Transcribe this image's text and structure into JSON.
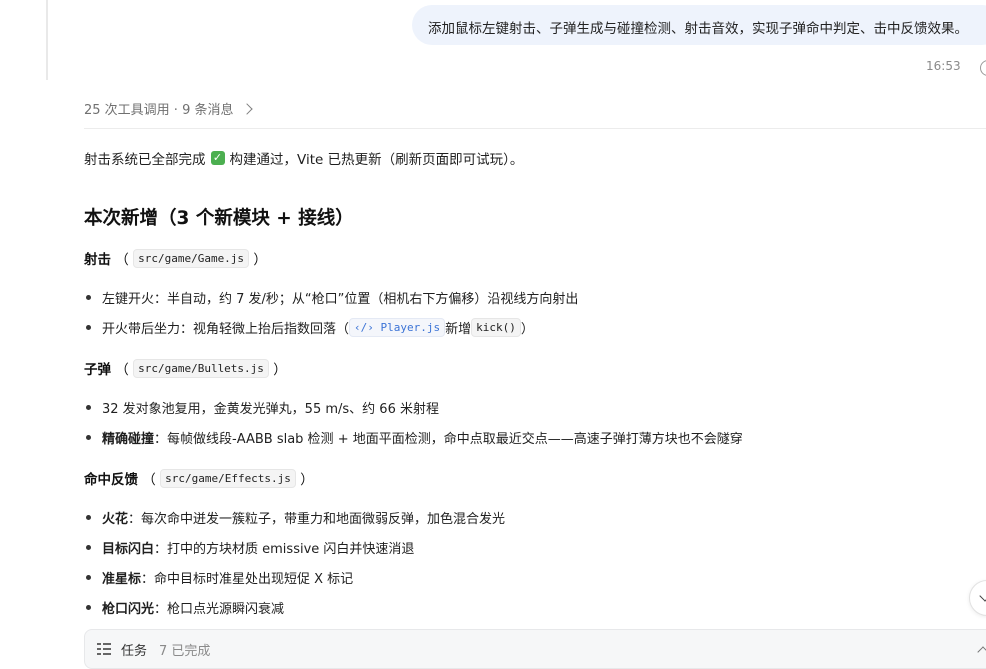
{
  "user_message": {
    "text": "添加鼠标左键射击、子弹生成与碰撞检测、射击音效，实现子弹命中判定、击中反馈效果。",
    "time": "16:53"
  },
  "tools_summary": "25 次工具调用 · 9 条消息",
  "intro": {
    "before": "射击系统已全部完成",
    "after": "构建通过，Vite 已热更新（刷新页面即可试玩）。"
  },
  "heading": "本次新增（3 个新模块 + 接线）",
  "sections": [
    {
      "title": "射击",
      "file": "src/game/Game.js",
      "bullets": [
        {
          "bold": "",
          "text": "左键开火：半自动，约 7 发/秒；从“枪口”位置（相机右下方偏移）沿视线方向射出"
        },
        {
          "bold": "",
          "text": "开火带后坐力：视角轻微上抬后指数回落（",
          "link": "Player.js",
          "mid": " 新增 ",
          "code": "kick()",
          "end": "）"
        }
      ]
    },
    {
      "title": "子弹",
      "file": "src/game/Bullets.js",
      "bullets": [
        {
          "bold": "",
          "text": "32 发对象池复用，金黄发光弹丸，55 m/s、约 66 米射程"
        },
        {
          "bold": "精确碰撞",
          "text": "：每帧做线段-AABB slab 检测 + 地面平面检测，命中点取最近交点——高速子弹打薄方块也不会隧穿"
        }
      ]
    },
    {
      "title": "命中反馈",
      "file": "src/game/Effects.js",
      "bullets": [
        {
          "bold": "火花",
          "text": "：每次命中迸发一簇粒子，带重力和地面微弱反弹，加色混合发光"
        },
        {
          "bold": "目标闪白",
          "text": "：打中的方块材质 emissive 闪白并快速消退"
        },
        {
          "bold": "准星标",
          "text": "：命中目标时准星处出现短促 X 标记"
        },
        {
          "bold": "枪口闪光",
          "text": "：枪口点光源瞬闪衰减"
        }
      ]
    }
  ],
  "tasks": {
    "label": "任务",
    "count": "7 已完成"
  },
  "icons": {
    "check": "check-mark-icon",
    "code_link": "code-icon",
    "tasks": "list-icon"
  },
  "colors": {
    "bubble": "#eef3fc",
    "link": "#3b73d6",
    "check": "#4caf50"
  }
}
